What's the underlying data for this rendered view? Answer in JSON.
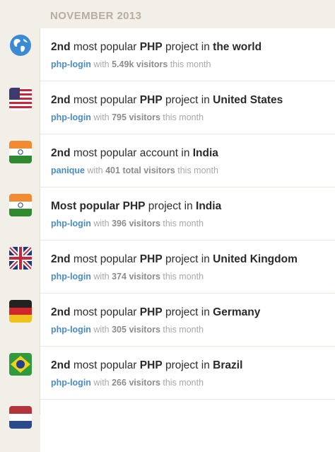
{
  "month": "NOVEMBER 2013",
  "entries": [
    {
      "rank": "2nd",
      "pre": " most popular ",
      "kind": "PHP",
      "mid": " project in ",
      "place": "the world",
      "project": "php-login",
      "with": " with ",
      "count": "5.49k visitors",
      "suffix": " this month",
      "flag": "globe-icon"
    },
    {
      "rank": "2nd",
      "pre": " most popular ",
      "kind": "PHP",
      "mid": " project in ",
      "place": "United States",
      "project": "php-login",
      "with": " with ",
      "count": "795 visitors",
      "suffix": " this month",
      "flag": "us-flag-icon"
    },
    {
      "rank": "2nd",
      "pre": " most popular account in ",
      "kind": "",
      "mid": "",
      "place": "India",
      "project": "panique",
      "with": " with ",
      "count": "401 total visitors",
      "suffix": " this month",
      "flag": "india-flag-icon"
    },
    {
      "rank": "Most popular",
      "pre": " ",
      "kind": "PHP",
      "mid": " project in ",
      "place": "India",
      "project": "php-login",
      "with": " with ",
      "count": "396 visitors",
      "suffix": " this month",
      "flag": "india-flag-icon"
    },
    {
      "rank": "2nd",
      "pre": " most popular ",
      "kind": "PHP",
      "mid": " project in ",
      "place": "United Kingdom",
      "project": "php-login",
      "with": " with ",
      "count": "374 visitors",
      "suffix": " this month",
      "flag": "uk-flag-icon"
    },
    {
      "rank": "2nd",
      "pre": " most popular ",
      "kind": "PHP",
      "mid": " project in ",
      "place": "Germany",
      "project": "php-login",
      "with": " with ",
      "count": "305 visitors",
      "suffix": " this month",
      "flag": "germany-flag-icon"
    },
    {
      "rank": "2nd",
      "pre": " most popular ",
      "kind": "PHP",
      "mid": " project in ",
      "place": "Brazil",
      "project": "php-login",
      "with": " with ",
      "count": "266 visitors",
      "suffix": " this month",
      "flag": "brazil-flag-icon"
    }
  ],
  "colors": {
    "link": "#4a8cc7",
    "month_heading": "#b8ad9e",
    "background": "#f2eee8"
  }
}
